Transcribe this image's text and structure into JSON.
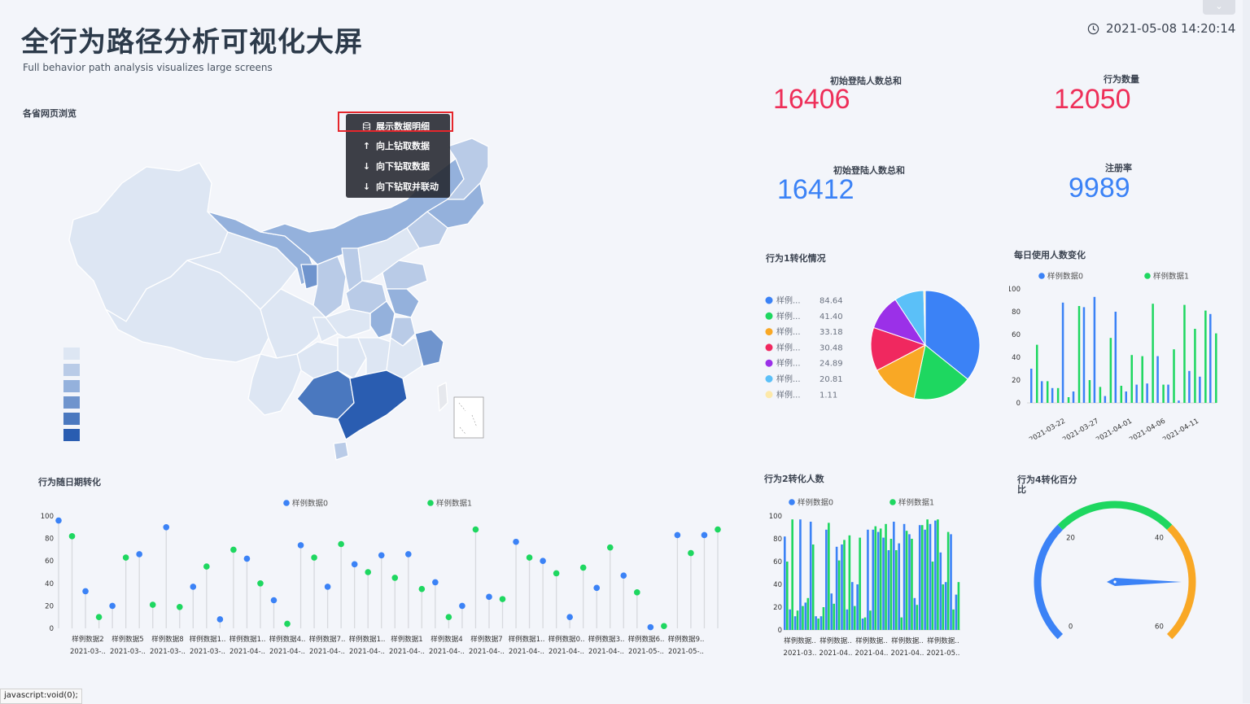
{
  "header": {
    "title": "全行为路径分析可视化大屏",
    "subtitle": "Full behavior path analysis visualizes large screens",
    "datetime": "2021-05-08 14:20:14",
    "collapse_icon": "chevron-down-icon"
  },
  "map": {
    "title": "各省网页浏览",
    "legend_colors": [
      "#dde6f3",
      "#b9cbe7",
      "#94b1dc",
      "#6f94cd",
      "#4a78bf",
      "#2a5db1"
    ]
  },
  "context_menu": {
    "items": [
      {
        "label": "展示数据明细",
        "icon": "database-icon"
      },
      {
        "label": "向上钻取数据",
        "icon": "arrow-up-icon"
      },
      {
        "label": "向下钻取数据",
        "icon": "arrow-down-icon"
      },
      {
        "label": "向下钻取并联动",
        "icon": "arrow-down-icon"
      }
    ]
  },
  "kpis": [
    {
      "label": "初始登陆人数总和",
      "value": "16406",
      "color": "#ee2f59"
    },
    {
      "label": "行为数量",
      "value": "12050",
      "color": "#ee2f59"
    },
    {
      "label": "初始登陆人数总和",
      "value": "16412",
      "color": "#3b82f6"
    },
    {
      "label": "注册率",
      "value": "9989",
      "color": "#3b82f6"
    }
  ],
  "status_bar": "javascript:void(0);",
  "chart_data": [
    {
      "type": "pie",
      "title": "行为1转化情况",
      "categories": [
        "样例...",
        "样例...",
        "样例...",
        "样例...",
        "样例...",
        "样例...",
        "样例..."
      ],
      "values": [
        84.64,
        41.4,
        33.18,
        30.48,
        24.89,
        20.81,
        1.11
      ],
      "colors": [
        "#3b82f6",
        "#1ed760",
        "#f9a825",
        "#f0285f",
        "#9b30e8",
        "#5bc0f8",
        "#fde9a9"
      ]
    },
    {
      "type": "bar",
      "title": "每日使用人数变化",
      "series": [
        {
          "name": "样例数据0",
          "values": [
            30,
            19,
            13,
            88,
            10,
            84,
            93,
            6,
            80,
            10,
            16,
            17,
            41,
            16,
            2,
            28,
            23,
            78
          ],
          "color": "#3b82f6"
        },
        {
          "name": "样例数据1",
          "values": [
            51,
            19,
            13,
            5,
            85,
            20,
            14,
            57,
            15,
            42,
            41,
            87,
            16,
            47,
            86,
            65,
            81,
            61
          ],
          "color": "#1ed760"
        }
      ],
      "xticks": [
        "2021-03-22",
        "2021-03-27",
        "2021-04-01",
        "2021-04-06",
        "2021-04-11"
      ],
      "yticks": [
        "0",
        "20",
        "40",
        "60",
        "80",
        "100"
      ],
      "ylim": [
        0,
        100
      ],
      "legend": "top"
    },
    {
      "type": "scatter",
      "title": "行为随日期转化",
      "series": [
        {
          "name": "样例数据0",
          "color": "#3b82f6"
        },
        {
          "name": "样例数据1",
          "color": "#1ed760"
        }
      ],
      "points": [
        [
          0,
          96
        ],
        [
          1,
          82
        ],
        [
          0,
          33
        ],
        [
          1,
          10
        ],
        [
          0,
          20
        ],
        [
          1,
          63
        ],
        [
          0,
          66
        ],
        [
          1,
          21
        ],
        [
          0,
          90
        ],
        [
          1,
          19
        ],
        [
          0,
          37
        ],
        [
          1,
          55
        ],
        [
          0,
          8
        ],
        [
          1,
          70
        ],
        [
          0,
          62
        ],
        [
          1,
          40
        ],
        [
          0,
          25
        ],
        [
          1,
          4
        ],
        [
          0,
          74
        ],
        [
          1,
          63
        ],
        [
          0,
          37
        ],
        [
          1,
          75
        ],
        [
          0,
          57
        ],
        [
          1,
          50
        ],
        [
          0,
          65
        ],
        [
          1,
          45
        ],
        [
          0,
          66
        ],
        [
          1,
          35
        ],
        [
          0,
          41
        ],
        [
          1,
          10
        ],
        [
          0,
          20
        ],
        [
          1,
          88
        ],
        [
          0,
          28
        ],
        [
          1,
          26
        ],
        [
          0,
          77
        ],
        [
          1,
          63
        ],
        [
          0,
          60
        ],
        [
          1,
          49
        ],
        [
          0,
          10
        ],
        [
          1,
          54
        ],
        [
          0,
          36
        ],
        [
          1,
          72
        ],
        [
          0,
          47
        ],
        [
          1,
          32
        ],
        [
          0,
          1
        ],
        [
          1,
          2
        ],
        [
          0,
          83
        ],
        [
          1,
          67
        ],
        [
          0,
          83
        ],
        [
          1,
          88
        ]
      ],
      "xlabels_top": [
        "样例数据2",
        "样例数据5",
        "样例数据8",
        "样例数据1..",
        "样例数据1..",
        "样例数据4..",
        "样例数据7..",
        "样例数据1..",
        "样例数据1",
        "样例数据4",
        "样例数据7",
        "样例数据1..",
        "样例数据0..",
        "样例数据3..",
        "样例数据6..",
        "样例数据9.."
      ],
      "xlabels_bottom": [
        "2021-03-..",
        "2021-03-..",
        "2021-03-..",
        "2021-03-..",
        "2021-04-..",
        "2021-04-..",
        "2021-04-..",
        "2021-04-..",
        "2021-04-..",
        "2021-04-..",
        "2021-04-..",
        "2021-04-..",
        "2021-04-..",
        "2021-04-..",
        "2021-05-..",
        "2021-05-.."
      ],
      "yticks": [
        "0",
        "20",
        "40",
        "60",
        "80",
        "100"
      ],
      "ylim": [
        0,
        100
      ],
      "legend": "top"
    },
    {
      "type": "bar",
      "title": "行为2转化人数",
      "series": [
        {
          "name": "样例数据0",
          "values": [
            82,
            18,
            12,
            97,
            24,
            95,
            12,
            12,
            88,
            32,
            73,
            75,
            18,
            42,
            40,
            10,
            88,
            88,
            86,
            81,
            70,
            95,
            76,
            93,
            84,
            28,
            92,
            88,
            93,
            96,
            68,
            42,
            84,
            31
          ],
          "color": "#3b82f6"
        },
        {
          "name": "样例数据1",
          "values": [
            60,
            97,
            17,
            21,
            28,
            75,
            10,
            20,
            94,
            23,
            61,
            79,
            83,
            21,
            81,
            11,
            17,
            91,
            89,
            93,
            80,
            70,
            11,
            87,
            80,
            22,
            92,
            97,
            60,
            97,
            40,
            86,
            18,
            42
          ],
          "color": "#1ed760"
        }
      ],
      "xlabels_top": [
        "样例数据..",
        "样例数据..",
        "样例数据..",
        "样例数据..",
        "样例数据.."
      ],
      "xlabels_bottom": [
        "2021-03..",
        "2021-04..",
        "2021-04..",
        "2021-04..",
        "2021-05.."
      ],
      "yticks": [
        "0",
        "20",
        "40",
        "60",
        "80",
        "100"
      ],
      "ylim": [
        0,
        100
      ],
      "legend": "top"
    },
    {
      "type": "gauge",
      "title": "行为4转化百分比",
      "min": 0,
      "max": 60,
      "value": 50,
      "ticks": [
        "0",
        "20",
        "40",
        "60"
      ],
      "colors": [
        "#3b82f6",
        "#1ed760",
        "#f9a825"
      ]
    }
  ]
}
